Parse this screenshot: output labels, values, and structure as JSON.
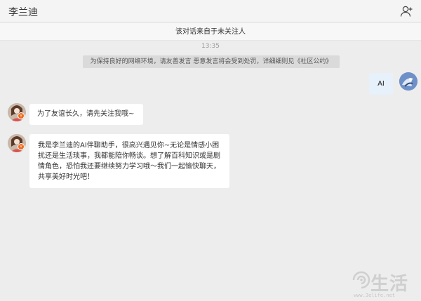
{
  "header": {
    "title": "李兰迪",
    "add_friend_icon": "add-user-icon"
  },
  "notice": {
    "text": "该对话来自于未关注人"
  },
  "chat": {
    "timestamp": "13:35",
    "system_message": "为保持良好的网络环境，请友善发言 恶意发言将会受到处罚，详细细则见《社区公约》",
    "messages": [
      {
        "sender": "me",
        "text": "AI"
      },
      {
        "sender": "李兰迪",
        "text": "为了友谊长久，请先关注我哦~"
      },
      {
        "sender": "李兰迪",
        "text": "我是李兰迪的AI伴聊助手，很高兴遇见你~无论是情感小困扰还是生活琐事，我都能陪你畅谈。想了解百科知识或是剧情角色，恐怕我还要继续努力学习哦～我们一起愉快聊天，共享美好时光吧！"
      }
    ]
  },
  "watermark": {
    "brand": "生活",
    "url": "www.3elife.net"
  },
  "colors": {
    "badge": "#f06a1d",
    "my_bubble": "#e6f1fb"
  }
}
